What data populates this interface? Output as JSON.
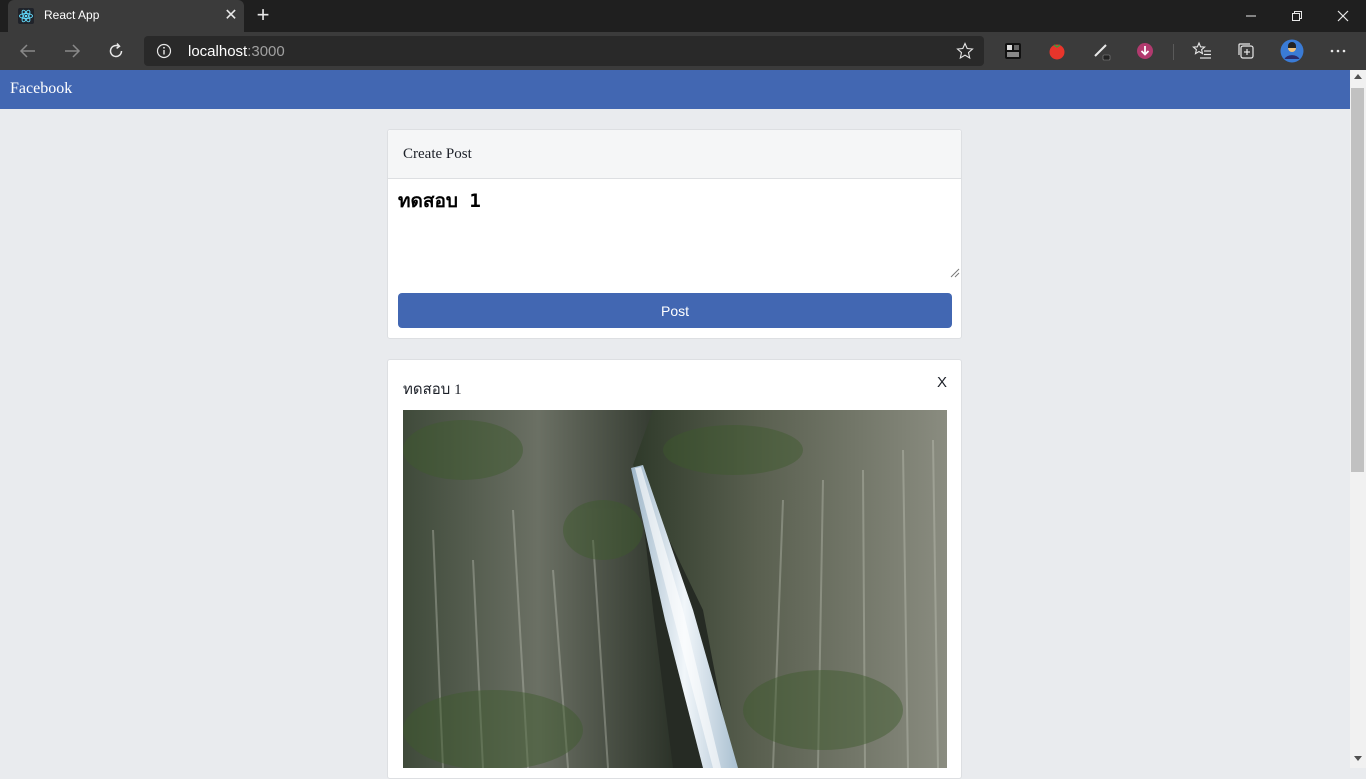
{
  "browser": {
    "tab_title": "React App",
    "url_host": "localhost",
    "url_port": ":3000"
  },
  "app": {
    "brand": "Facebook",
    "primary_color": "#4267b2"
  },
  "create_post": {
    "title": "Create Post",
    "textarea_value": "ทดสอบ 1",
    "post_button": "Post"
  },
  "feed": {
    "posts": [
      {
        "text": "ทดสอบ 1",
        "close_label": "X",
        "image": "waterfall-photo"
      }
    ]
  }
}
